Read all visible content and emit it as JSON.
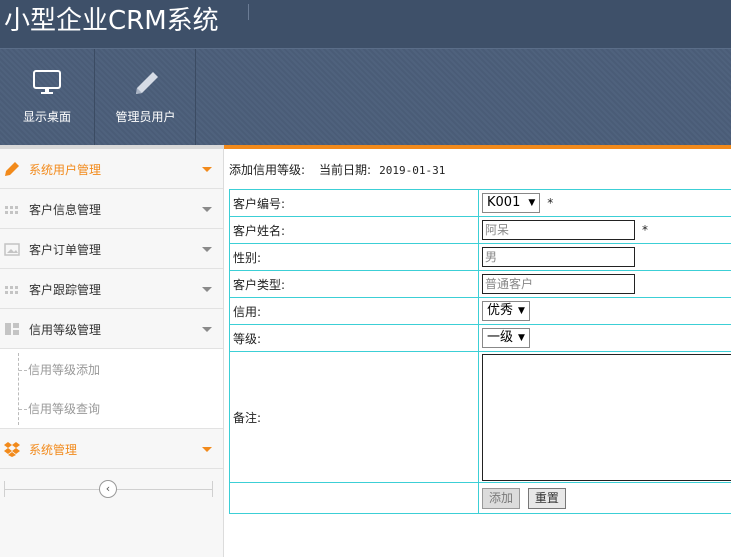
{
  "app": {
    "title": "小型企业CRM系统"
  },
  "nav": [
    {
      "label": "显示桌面",
      "icon": "monitor-icon"
    },
    {
      "label": "管理员用户",
      "icon": "pencil-icon"
    }
  ],
  "sidebar": {
    "items": [
      {
        "label": "系统用户管理",
        "icon": "pencil-icon",
        "active": true
      },
      {
        "label": "客户信息管理",
        "icon": "grid-icon"
      },
      {
        "label": "客户订单管理",
        "icon": "image-icon"
      },
      {
        "label": "客户跟踪管理",
        "icon": "grid-icon"
      },
      {
        "label": "信用等级管理",
        "icon": "layout-icon"
      },
      {
        "label": "系统管理",
        "icon": "dropbox-icon",
        "active": true
      }
    ],
    "subitems": [
      {
        "label": "信用等级添加"
      },
      {
        "label": "信用等级查询"
      }
    ]
  },
  "main": {
    "heading": "添加信用等级:",
    "date_label": "当前日期:",
    "date_value": "2019-01-31",
    "form": {
      "customer_no_label": "客户编号:",
      "customer_no_value": "K001",
      "customer_name_label": "客户姓名:",
      "customer_name_value": "阿呆",
      "gender_label": "性别:",
      "gender_value": "男",
      "customer_type_label": "客户类型:",
      "customer_type_value": "普通客户",
      "credit_label": "信用:",
      "credit_value": "优秀",
      "level_label": "等级:",
      "level_value": "一级",
      "remark_label": "备注:",
      "remark_value": "",
      "required_mark": "*",
      "add_button": "添加",
      "reset_button": "重置"
    }
  },
  "colors": {
    "header": "#3e5069",
    "accent": "#f28a1b",
    "table_border": "#3ccfd6"
  }
}
